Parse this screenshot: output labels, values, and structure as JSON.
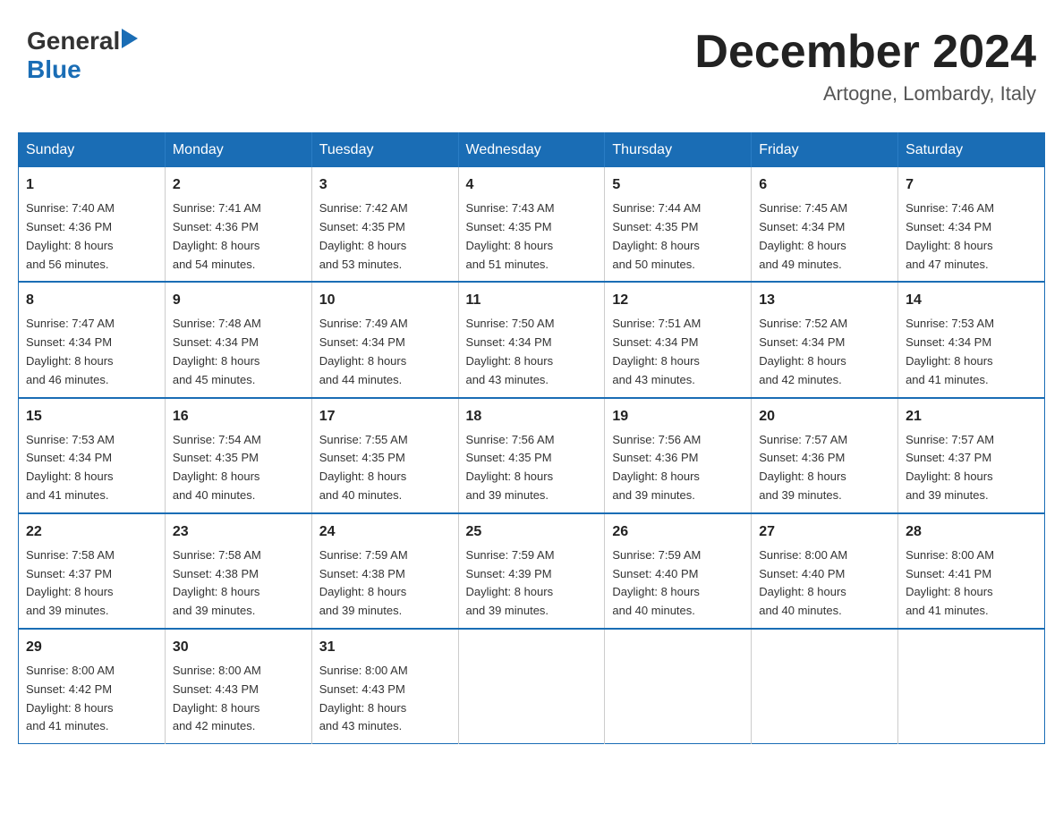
{
  "header": {
    "logo": {
      "general": "General",
      "blue": "Blue",
      "arrow": "▶"
    },
    "title": "December 2024",
    "location": "Artogne, Lombardy, Italy"
  },
  "days_of_week": [
    "Sunday",
    "Monday",
    "Tuesday",
    "Wednesday",
    "Thursday",
    "Friday",
    "Saturday"
  ],
  "weeks": [
    [
      {
        "day": "1",
        "sunrise": "7:40 AM",
        "sunset": "4:36 PM",
        "daylight": "8 hours and 56 minutes."
      },
      {
        "day": "2",
        "sunrise": "7:41 AM",
        "sunset": "4:36 PM",
        "daylight": "8 hours and 54 minutes."
      },
      {
        "day": "3",
        "sunrise": "7:42 AM",
        "sunset": "4:35 PM",
        "daylight": "8 hours and 53 minutes."
      },
      {
        "day": "4",
        "sunrise": "7:43 AM",
        "sunset": "4:35 PM",
        "daylight": "8 hours and 51 minutes."
      },
      {
        "day": "5",
        "sunrise": "7:44 AM",
        "sunset": "4:35 PM",
        "daylight": "8 hours and 50 minutes."
      },
      {
        "day": "6",
        "sunrise": "7:45 AM",
        "sunset": "4:34 PM",
        "daylight": "8 hours and 49 minutes."
      },
      {
        "day": "7",
        "sunrise": "7:46 AM",
        "sunset": "4:34 PM",
        "daylight": "8 hours and 47 minutes."
      }
    ],
    [
      {
        "day": "8",
        "sunrise": "7:47 AM",
        "sunset": "4:34 PM",
        "daylight": "8 hours and 46 minutes."
      },
      {
        "day": "9",
        "sunrise": "7:48 AM",
        "sunset": "4:34 PM",
        "daylight": "8 hours and 45 minutes."
      },
      {
        "day": "10",
        "sunrise": "7:49 AM",
        "sunset": "4:34 PM",
        "daylight": "8 hours and 44 minutes."
      },
      {
        "day": "11",
        "sunrise": "7:50 AM",
        "sunset": "4:34 PM",
        "daylight": "8 hours and 43 minutes."
      },
      {
        "day": "12",
        "sunrise": "7:51 AM",
        "sunset": "4:34 PM",
        "daylight": "8 hours and 43 minutes."
      },
      {
        "day": "13",
        "sunrise": "7:52 AM",
        "sunset": "4:34 PM",
        "daylight": "8 hours and 42 minutes."
      },
      {
        "day": "14",
        "sunrise": "7:53 AM",
        "sunset": "4:34 PM",
        "daylight": "8 hours and 41 minutes."
      }
    ],
    [
      {
        "day": "15",
        "sunrise": "7:53 AM",
        "sunset": "4:34 PM",
        "daylight": "8 hours and 41 minutes."
      },
      {
        "day": "16",
        "sunrise": "7:54 AM",
        "sunset": "4:35 PM",
        "daylight": "8 hours and 40 minutes."
      },
      {
        "day": "17",
        "sunrise": "7:55 AM",
        "sunset": "4:35 PM",
        "daylight": "8 hours and 40 minutes."
      },
      {
        "day": "18",
        "sunrise": "7:56 AM",
        "sunset": "4:35 PM",
        "daylight": "8 hours and 39 minutes."
      },
      {
        "day": "19",
        "sunrise": "7:56 AM",
        "sunset": "4:36 PM",
        "daylight": "8 hours and 39 minutes."
      },
      {
        "day": "20",
        "sunrise": "7:57 AM",
        "sunset": "4:36 PM",
        "daylight": "8 hours and 39 minutes."
      },
      {
        "day": "21",
        "sunrise": "7:57 AM",
        "sunset": "4:37 PM",
        "daylight": "8 hours and 39 minutes."
      }
    ],
    [
      {
        "day": "22",
        "sunrise": "7:58 AM",
        "sunset": "4:37 PM",
        "daylight": "8 hours and 39 minutes."
      },
      {
        "day": "23",
        "sunrise": "7:58 AM",
        "sunset": "4:38 PM",
        "daylight": "8 hours and 39 minutes."
      },
      {
        "day": "24",
        "sunrise": "7:59 AM",
        "sunset": "4:38 PM",
        "daylight": "8 hours and 39 minutes."
      },
      {
        "day": "25",
        "sunrise": "7:59 AM",
        "sunset": "4:39 PM",
        "daylight": "8 hours and 39 minutes."
      },
      {
        "day": "26",
        "sunrise": "7:59 AM",
        "sunset": "4:40 PM",
        "daylight": "8 hours and 40 minutes."
      },
      {
        "day": "27",
        "sunrise": "8:00 AM",
        "sunset": "4:40 PM",
        "daylight": "8 hours and 40 minutes."
      },
      {
        "day": "28",
        "sunrise": "8:00 AM",
        "sunset": "4:41 PM",
        "daylight": "8 hours and 41 minutes."
      }
    ],
    [
      {
        "day": "29",
        "sunrise": "8:00 AM",
        "sunset": "4:42 PM",
        "daylight": "8 hours and 41 minutes."
      },
      {
        "day": "30",
        "sunrise": "8:00 AM",
        "sunset": "4:43 PM",
        "daylight": "8 hours and 42 minutes."
      },
      {
        "day": "31",
        "sunrise": "8:00 AM",
        "sunset": "4:43 PM",
        "daylight": "8 hours and 43 minutes."
      },
      null,
      null,
      null,
      null
    ]
  ],
  "labels": {
    "sunrise": "Sunrise:",
    "sunset": "Sunset:",
    "daylight": "Daylight:"
  }
}
